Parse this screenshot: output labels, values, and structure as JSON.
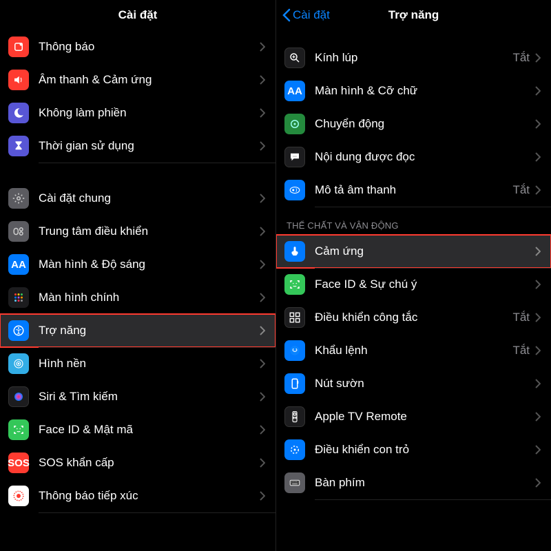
{
  "left": {
    "title": "Cài đặt",
    "items": [
      {
        "label": "Thông báo"
      },
      {
        "label": "Âm thanh & Cảm ứng"
      },
      {
        "label": "Không làm phiền"
      },
      {
        "label": "Thời gian sử dụng"
      },
      {
        "label": "Cài đặt chung"
      },
      {
        "label": "Trung tâm điều khiển"
      },
      {
        "label": "Màn hình & Độ sáng"
      },
      {
        "label": "Màn hình chính"
      },
      {
        "label": "Trợ năng"
      },
      {
        "label": "Hình nền"
      },
      {
        "label": "Siri & Tìm kiếm"
      },
      {
        "label": "Face ID & Mật mã"
      },
      {
        "label": "SOS khẩn cấp"
      },
      {
        "label": "Thông báo tiếp xúc"
      }
    ],
    "sos_text": "SOS"
  },
  "right": {
    "back": "Cài đặt",
    "title": "Trợ năng",
    "section_header": "THỂ CHẤT VÀ VẬN ĐỘNG",
    "off_value": "Tắt",
    "items_top": [
      {
        "label": "Kính lúp",
        "value": "Tắt"
      },
      {
        "label": "Màn hình & Cỡ chữ"
      },
      {
        "label": "Chuyển động"
      },
      {
        "label": "Nội dung được đọc"
      },
      {
        "label": "Mô tả âm thanh",
        "value": "Tắt"
      }
    ],
    "items_bottom": [
      {
        "label": "Cảm ứng"
      },
      {
        "label": "Face ID & Sự chú ý"
      },
      {
        "label": "Điều khiển công tắc",
        "value": "Tắt"
      },
      {
        "label": "Khẩu lệnh",
        "value": "Tắt"
      },
      {
        "label": "Nút sườn"
      },
      {
        "label": "Apple TV Remote"
      },
      {
        "label": "Điều khiển con trỏ"
      },
      {
        "label": "Bàn phím"
      }
    ]
  }
}
